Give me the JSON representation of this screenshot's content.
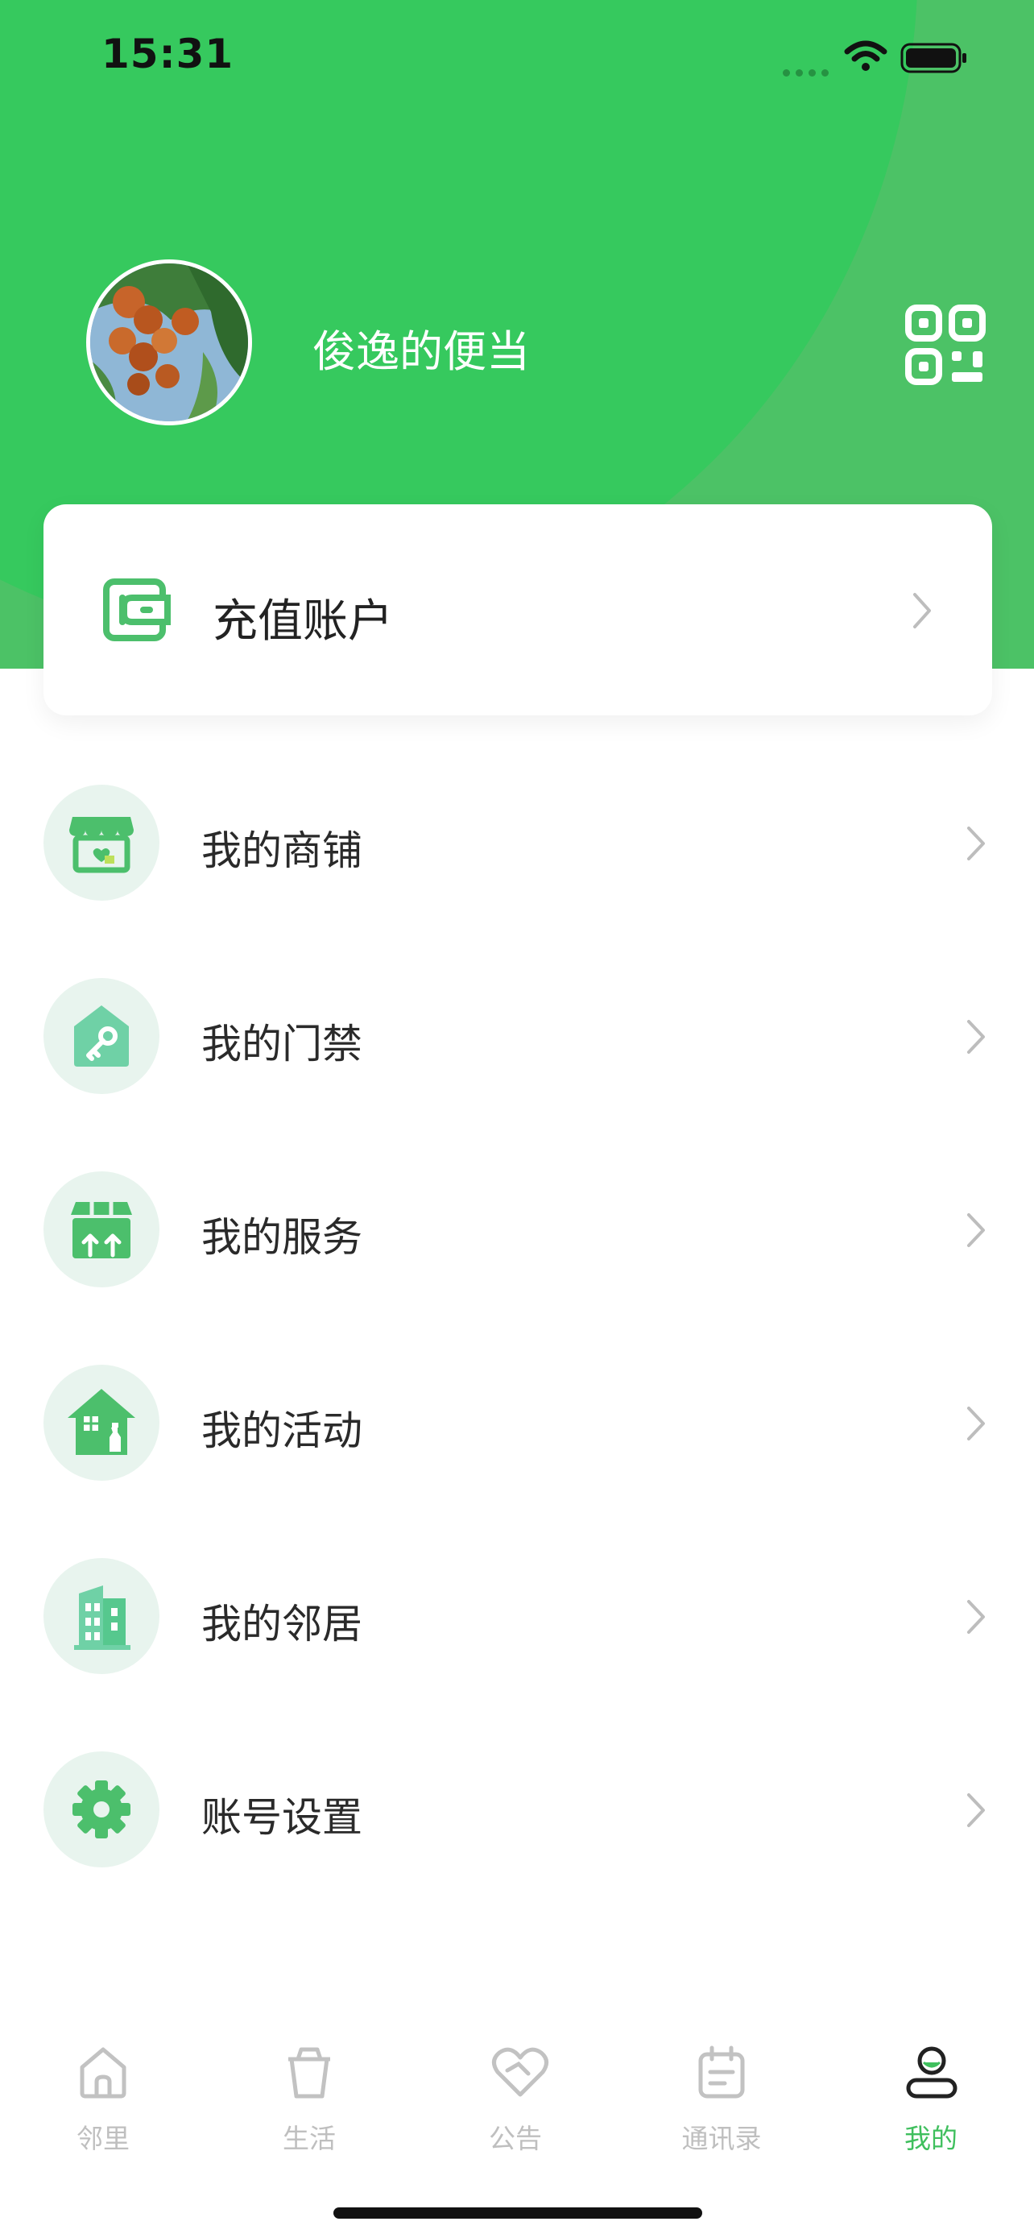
{
  "status": {
    "time": "15:31"
  },
  "profile": {
    "name": "俊逸的便当"
  },
  "wallet": {
    "label": "充值账户"
  },
  "menu": [
    {
      "label": "我的商铺",
      "icon": "shop-icon"
    },
    {
      "label": "我的门禁",
      "icon": "key-house-icon"
    },
    {
      "label": "我的服务",
      "icon": "package-icon"
    },
    {
      "label": "我的活动",
      "icon": "house-cleaning-icon"
    },
    {
      "label": "我的邻居",
      "icon": "building-icon"
    },
    {
      "label": "账号设置",
      "icon": "gear-icon"
    }
  ],
  "tabs": [
    {
      "label": "邻里",
      "icon": "home-icon"
    },
    {
      "label": "生活",
      "icon": "cup-icon"
    },
    {
      "label": "公告",
      "icon": "heart-icon"
    },
    {
      "label": "通讯录",
      "icon": "calendar-icon"
    },
    {
      "label": "我的",
      "icon": "user-icon",
      "active": true
    }
  ],
  "colors": {
    "primary": "#36c95e",
    "header": "#4cc266",
    "icon_green": "#4cbf6c",
    "icon_bg": "#e8f4ee",
    "active_tab": "#3fbf5d",
    "inactive_tab": "#bfbfbf"
  }
}
